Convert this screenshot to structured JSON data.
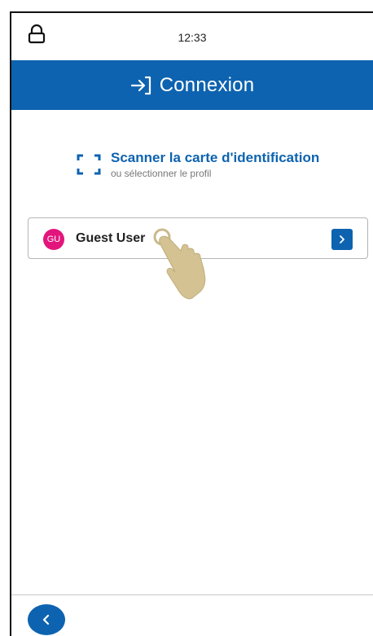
{
  "status": {
    "time": "12:33"
  },
  "header": {
    "title": "Connexion"
  },
  "scan": {
    "title": "Scanner la carte d'identification",
    "subtitle": "ou sélectionner le profil"
  },
  "profiles": [
    {
      "initials": "GU",
      "name": "Guest User",
      "avatar_color": "#e3157c"
    }
  ],
  "colors": {
    "primary": "#0d63b0"
  },
  "icons": {
    "lock": "lock-icon",
    "login": "login-arrow-icon",
    "scan": "scan-frame-icon",
    "chevron": "chevron-right-icon",
    "back": "chevron-left-icon",
    "pointer": "hand-pointer-icon"
  }
}
